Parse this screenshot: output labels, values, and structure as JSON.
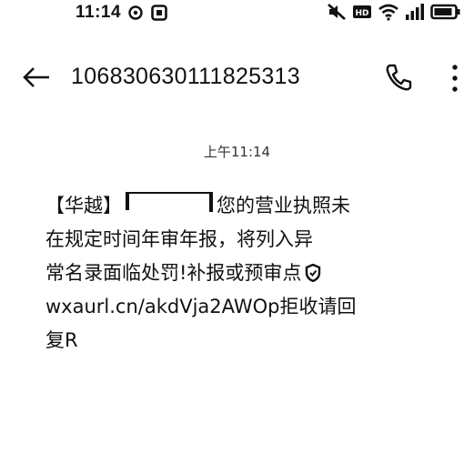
{
  "status_bar": {
    "time": "11:14",
    "left_icons": [
      "sync-icon",
      "app-notification-icon"
    ],
    "right_icons": [
      "mute-icon",
      "hd-icon",
      "wifi-icon",
      "signal-icon",
      "battery-icon"
    ],
    "hd_label": "HD"
  },
  "header": {
    "back_icon": "arrow-left-icon",
    "contact_number": "106830630111825313",
    "call_icon": "phone-icon",
    "more_icon": "more-vertical-icon"
  },
  "conversation": {
    "timestamp": "上午11:14",
    "message": {
      "sender_tag": "【华越】",
      "line1_rest": "您的营业执照未",
      "line2": "在规定时间年审年报，将列入异",
      "line3": "常名录面临处罚!补报或预审点",
      "link_text": "wxaurl.cn/akdVja2AWOp",
      "line4_rest": "拒收请回",
      "line5": "复R"
    }
  }
}
